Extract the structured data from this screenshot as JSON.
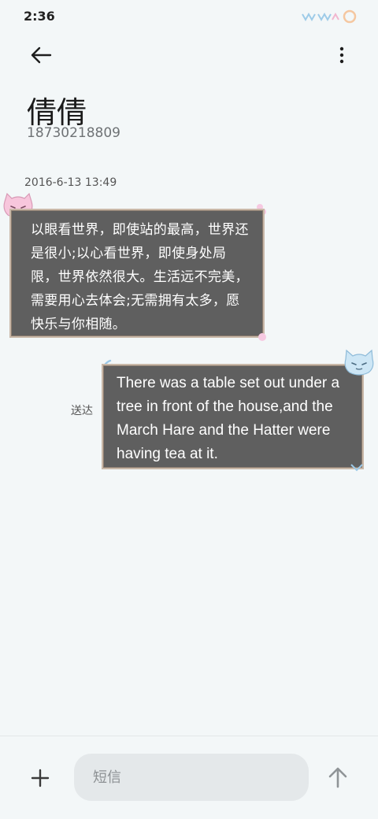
{
  "status_bar": {
    "time": "2:36"
  },
  "header": {
    "contact_name": "倩倩",
    "contact_number": "18730218809"
  },
  "conversation": {
    "timestamp": "2016-6-13 13:49",
    "messages": [
      {
        "direction": "incoming",
        "text": "以眼看世界，即使站的最高，世界还是很小;以心看世界，即使身处局限，世界依然很大。生活远不完美，需要用心去体会;无需拥有太多，愿快乐与你相随。"
      },
      {
        "direction": "outgoing",
        "text": "There was a table set out under a tree in front of the house,and the March Hare and the Hatter were having tea at it.",
        "status": "送达"
      }
    ]
  },
  "composer": {
    "placeholder": "短信",
    "value": ""
  },
  "colors": {
    "background": "#f3f7f8",
    "bubble": "#5f5f5f",
    "bubble_text": "#ffffff",
    "input_bg": "#e4e8ea"
  },
  "icons": {
    "back": "arrow-left-icon",
    "more": "more-vertical-icon",
    "add": "plus-icon",
    "send": "arrow-up-icon"
  }
}
